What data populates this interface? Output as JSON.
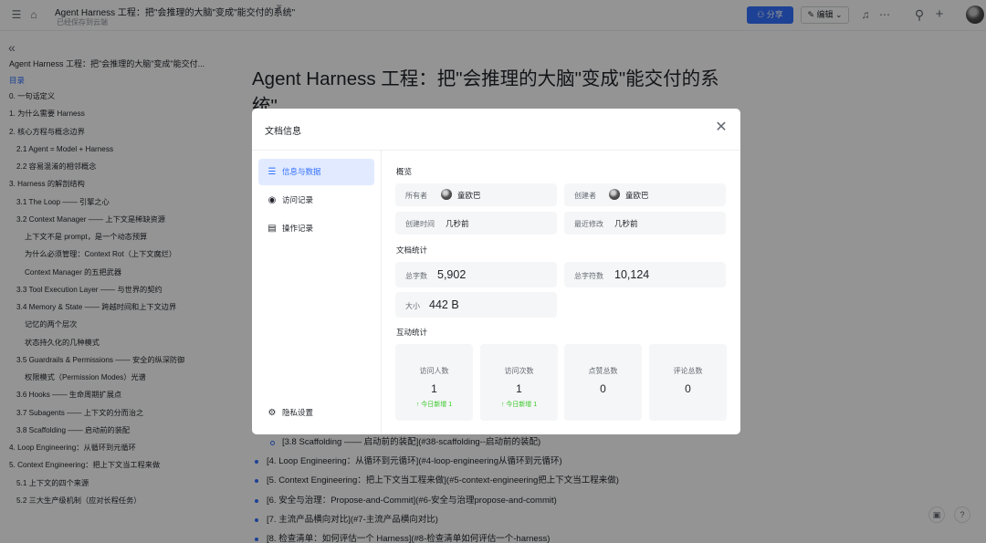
{
  "topbar": {
    "doc_title": "Agent Harness 工程：把\"会推理的大脑\"变成\"能交付的系统\"",
    "save_status": "已经保存到云端",
    "pin_glyph": "⊼",
    "share_label": "分享",
    "edit_label": "编辑"
  },
  "sidebar": {
    "doc_title": "Agent Harness 工程：把\"会推理的大脑\"变成\"能交付...",
    "toc_label": "目录",
    "toc": [
      {
        "label": "0. 一句话定义",
        "indent": 0
      },
      {
        "label": "1. 为什么需要 Harness",
        "indent": 0
      },
      {
        "label": "2. 核心方程与概念边界",
        "indent": 0
      },
      {
        "label": "2.1 Agent = Model + Harness",
        "indent": 1
      },
      {
        "label": "2.2 容易混淆的相邻概念",
        "indent": 1
      },
      {
        "label": "3. Harness 的解剖结构",
        "indent": 0
      },
      {
        "label": "3.1 The Loop —— 引擎之心",
        "indent": 1
      },
      {
        "label": "3.2 Context Manager —— 上下文是稀缺资源",
        "indent": 1
      },
      {
        "label": "上下文不是 prompt，是一个动态预算",
        "indent": 2
      },
      {
        "label": "为什么必须管理：Context Rot（上下文腐烂）",
        "indent": 2
      },
      {
        "label": "Context Manager 的五把武器",
        "indent": 2
      },
      {
        "label": "3.3 Tool Execution Layer —— 与世界的契约",
        "indent": 1
      },
      {
        "label": "3.4 Memory & State —— 跨越时间和上下文边界",
        "indent": 1
      },
      {
        "label": "记忆的两个层次",
        "indent": 2
      },
      {
        "label": "状态持久化的几种模式",
        "indent": 2
      },
      {
        "label": "3.5 Guardrails & Permissions —— 安全的纵深防御",
        "indent": 1
      },
      {
        "label": "权限模式（Permission Modes）光谱",
        "indent": 2
      },
      {
        "label": "3.6 Hooks —— 生命周期扩展点",
        "indent": 1
      },
      {
        "label": "3.7 Subagents —— 上下文的分而治之",
        "indent": 1
      },
      {
        "label": "3.8 Scaffolding —— 启动前的装配",
        "indent": 1
      },
      {
        "label": "4. Loop Engineering：从循环到元循环",
        "indent": 0
      },
      {
        "label": "5. Context Engineering：把上下文当工程来做",
        "indent": 0
      },
      {
        "label": "5.1 上下文的四个来源",
        "indent": 1
      },
      {
        "label": "5.2 三大生产级机制（应对长程任务）",
        "indent": 1
      }
    ]
  },
  "main": {
    "heading": "Agent Harness 工程：把\"会推理的大脑\"变成\"能交付的系统\"",
    "bullets": [
      {
        "text": "[3.8 Scaffolding —— 启动前的装配](#38-scaffolding--启动前的装配)",
        "sub": true
      },
      {
        "text": "[4. Loop Engineering：从循环到元循环](#4-loop-engineering从循环到元循环)",
        "sub": false
      },
      {
        "text": "[5. Context Engineering：把上下文当工程来做](#5-context-engineering把上下文当工程来做)",
        "sub": false
      },
      {
        "text": "[6. 安全与治理：Propose-and-Commit](#6-安全与治理propose-and-commit)",
        "sub": false
      },
      {
        "text": "[7. 主流产品横向对比](#7-主流产品横向对比)",
        "sub": false
      },
      {
        "text": "[8. 检查清单：如何评估一个 Harness](#8-检查清单如何评估一个-harness)",
        "sub": false
      }
    ]
  },
  "modal": {
    "title": "文档信息",
    "nav": [
      {
        "label": "信息与数据",
        "icon": "list-icon",
        "glyph": "☰",
        "active": true
      },
      {
        "label": "访问记录",
        "icon": "eye-icon",
        "glyph": "◉",
        "active": false
      },
      {
        "label": "操作记录",
        "icon": "history-icon",
        "glyph": "▤",
        "active": false
      }
    ],
    "privacy_label": "隐私设置",
    "overview": {
      "title": "概览",
      "owner_label": "所有者",
      "owner_name": "童欧巴",
      "creator_label": "创建者",
      "creator_name": "童欧巴",
      "created_label": "创建时间",
      "created_value": "几秒前",
      "modified_label": "最近修改",
      "modified_value": "几秒前"
    },
    "doc_stats": {
      "title": "文档统计",
      "words_label": "总字数",
      "words_value": "5,902",
      "chars_label": "总字符数",
      "chars_value": "10,124",
      "size_label": "大小",
      "size_value": "442 B"
    },
    "interaction": {
      "title": "互动统计",
      "items": [
        {
          "label": "访问人数",
          "value": "1",
          "sub": "↑ 今日新增 1"
        },
        {
          "label": "访问次数",
          "value": "1",
          "sub": "↑ 今日新增 1"
        },
        {
          "label": "点赞总数",
          "value": "0",
          "sub": ""
        },
        {
          "label": "评论总数",
          "value": "0",
          "sub": ""
        }
      ]
    }
  },
  "colors": {
    "accent": "#3370ff",
    "positive": "#34c724",
    "overlay": "rgba(0,0,0,0.42)"
  }
}
